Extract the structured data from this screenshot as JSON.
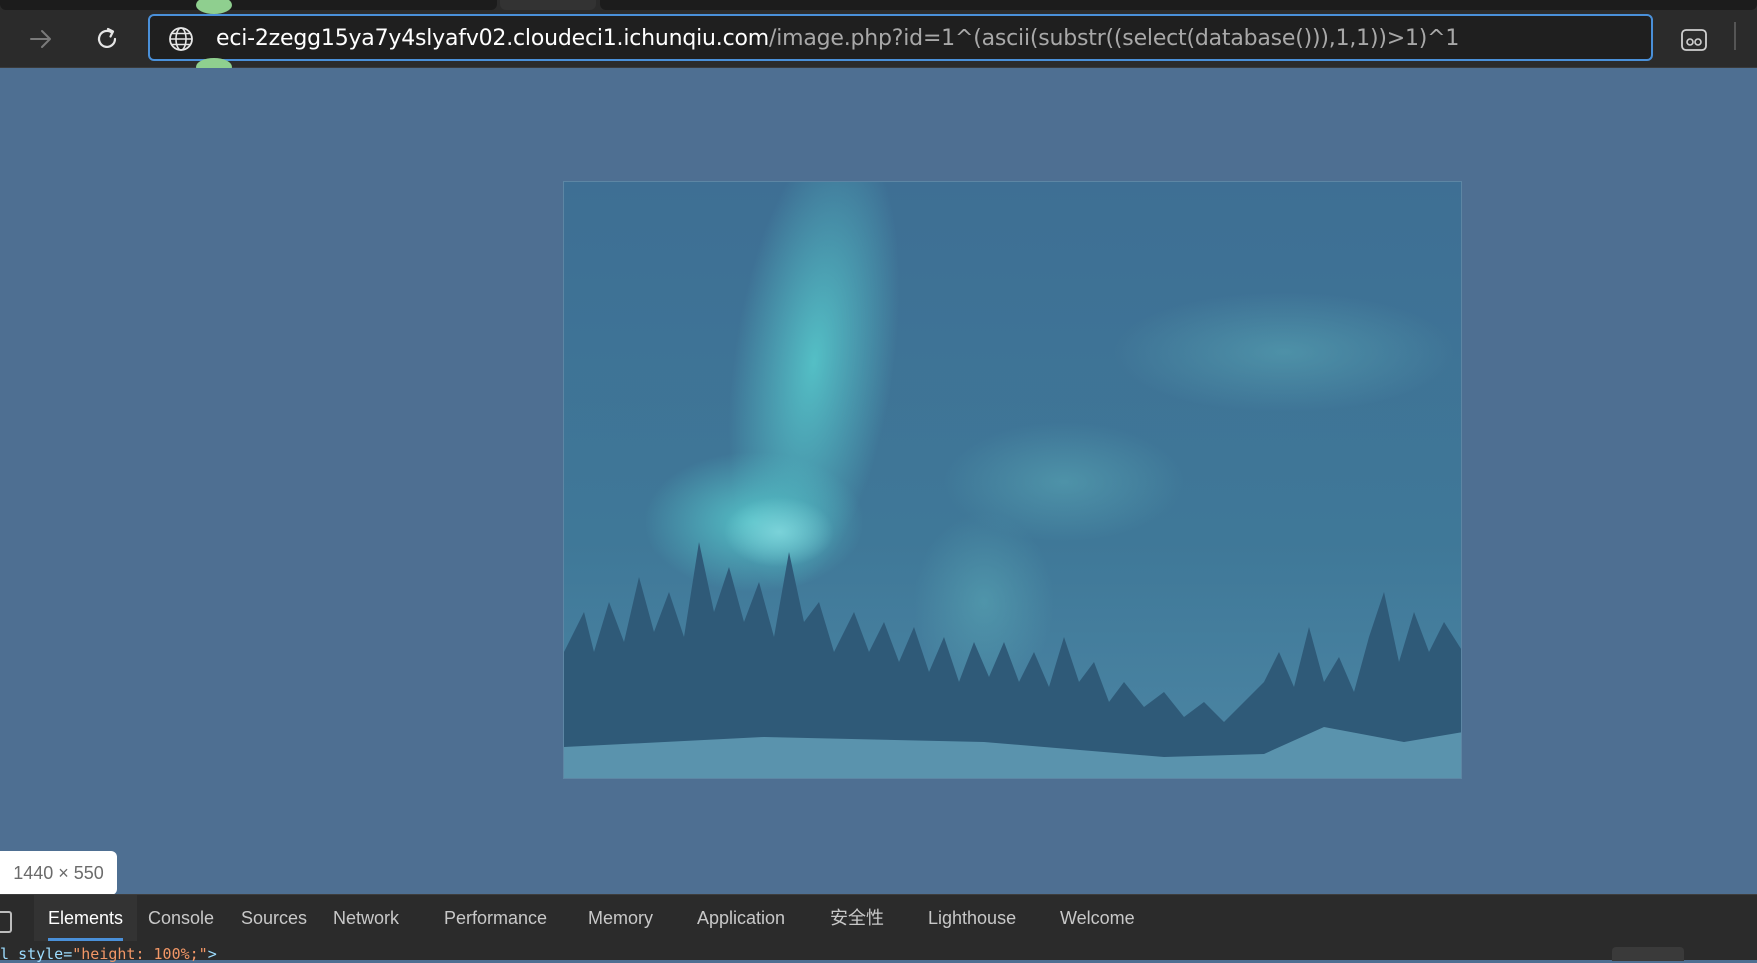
{
  "browser": {
    "url_host": "eci-2zegg15ya7y4slyafv02.cloudeci1.ichunqiu.com",
    "url_rest": "/image.php?id=1^(ascii(substr((select(database())),1,1))>1)^1",
    "icons": {
      "forward": "arrow-right-icon",
      "reload": "reload-icon",
      "site": "globe-icon",
      "reader": "immersive-reader-icon"
    }
  },
  "page": {
    "image_alt": "aurora-over-forest-image",
    "dimension_badge": "1440 × 550"
  },
  "devtools": {
    "tabs": [
      {
        "label": "Elements",
        "active": true
      },
      {
        "label": "Console"
      },
      {
        "label": "Sources"
      },
      {
        "label": "Network"
      },
      {
        "label": "Performance"
      },
      {
        "label": "Memory"
      },
      {
        "label": "Application"
      },
      {
        "label": "安全性"
      },
      {
        "label": "Lighthouse"
      },
      {
        "label": "Welcome"
      }
    ],
    "code_prefix": "l ",
    "code_attr": "style=",
    "code_value": "\"height: 100%;\"",
    "code_suffix": ">"
  },
  "colors": {
    "accent": "#4a90d9",
    "page_background": "#4e6f92",
    "toolbar": "#2b2b2b"
  }
}
